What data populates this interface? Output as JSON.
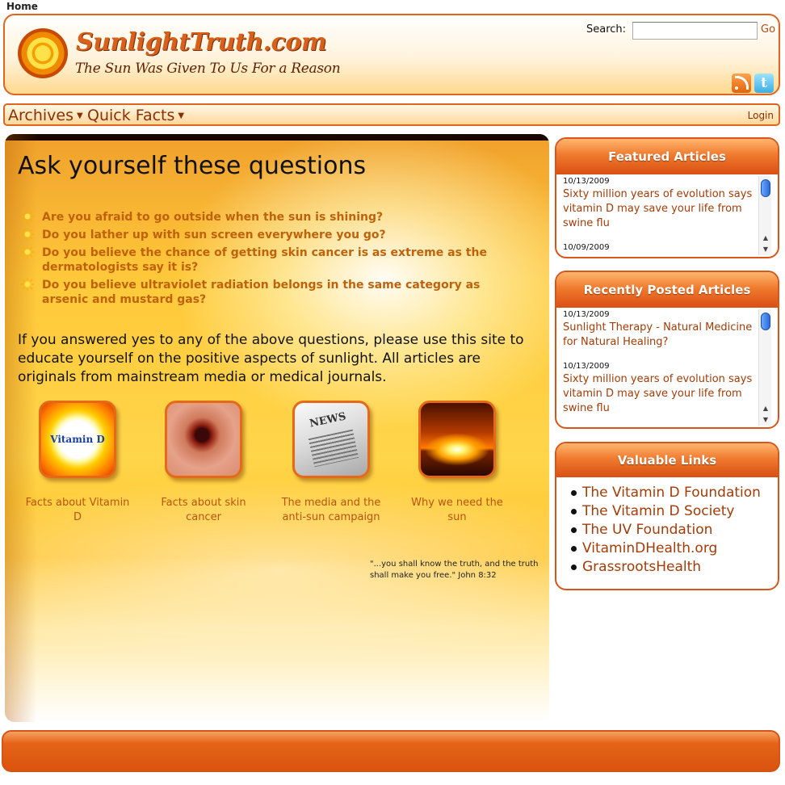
{
  "page": {
    "label": "Home"
  },
  "header": {
    "logo_title": "SunlightTruth.com",
    "tagline": "The Sun Was Given To Us For a Reason",
    "search_label": "Search:",
    "search_value": "",
    "go_label": "Go",
    "twitter_glyph": "t",
    "icons": [
      "sun-logo-icon",
      "rss-icon",
      "twitter-icon"
    ]
  },
  "nav": {
    "items": [
      {
        "label": "Archives"
      },
      {
        "label": "Quick Facts"
      }
    ],
    "login_label": "Login"
  },
  "main": {
    "title": "Ask yourself these questions",
    "questions": [
      "Are you afraid to go outside when the sun is shining?",
      "Do you lather up with sun screen everywhere you go?",
      "Do you believe the chance of getting skin cancer is as extreme as the dermatologists say it is?",
      "Do you believe ultraviolet radiation belongs in the same category as arsenic and mustard gas?"
    ],
    "intro": "If you answered yes to any of the above questions, please use this site to educate yourself on the positive aspects of sunlight. All articles are originals from mainstream media or medical journals.",
    "tiles": [
      {
        "caption": "Facts about Vitamin D",
        "thumb_text": "Vitamin D"
      },
      {
        "caption": "Facts about skin cancer"
      },
      {
        "caption": "The media and the anti-sun campaign"
      },
      {
        "caption": "Why we need the sun"
      }
    ],
    "quote": "\"...you shall know the truth, and the truth shall make you free.\" John 8:32"
  },
  "featured": {
    "heading": "Featured Articles",
    "articles": [
      {
        "date": "10/13/2009",
        "title": "Sixty million years of evolution says vitamin D may save your life from swine flu"
      },
      {
        "date": "10/09/2009",
        "title": ""
      }
    ]
  },
  "recent": {
    "heading": "Recently Posted Articles",
    "articles": [
      {
        "date": "10/13/2009",
        "title": "Sunlight Therapy - Natural Medicine for Natural Healing?"
      },
      {
        "date": "10/13/2009",
        "title": "Sixty million years of evolution says vitamin D may save your life from swine flu"
      }
    ]
  },
  "links": {
    "heading": "Valuable Links",
    "items": [
      "The Vitamin D Foundation",
      "The Vitamin D Society",
      "The UV Foundation",
      "VitaminDHealth.org",
      "GrassrootsHealth"
    ]
  },
  "colors": {
    "accent": "#e0651d",
    "link": "#a23c08",
    "question": "#c0620c"
  }
}
